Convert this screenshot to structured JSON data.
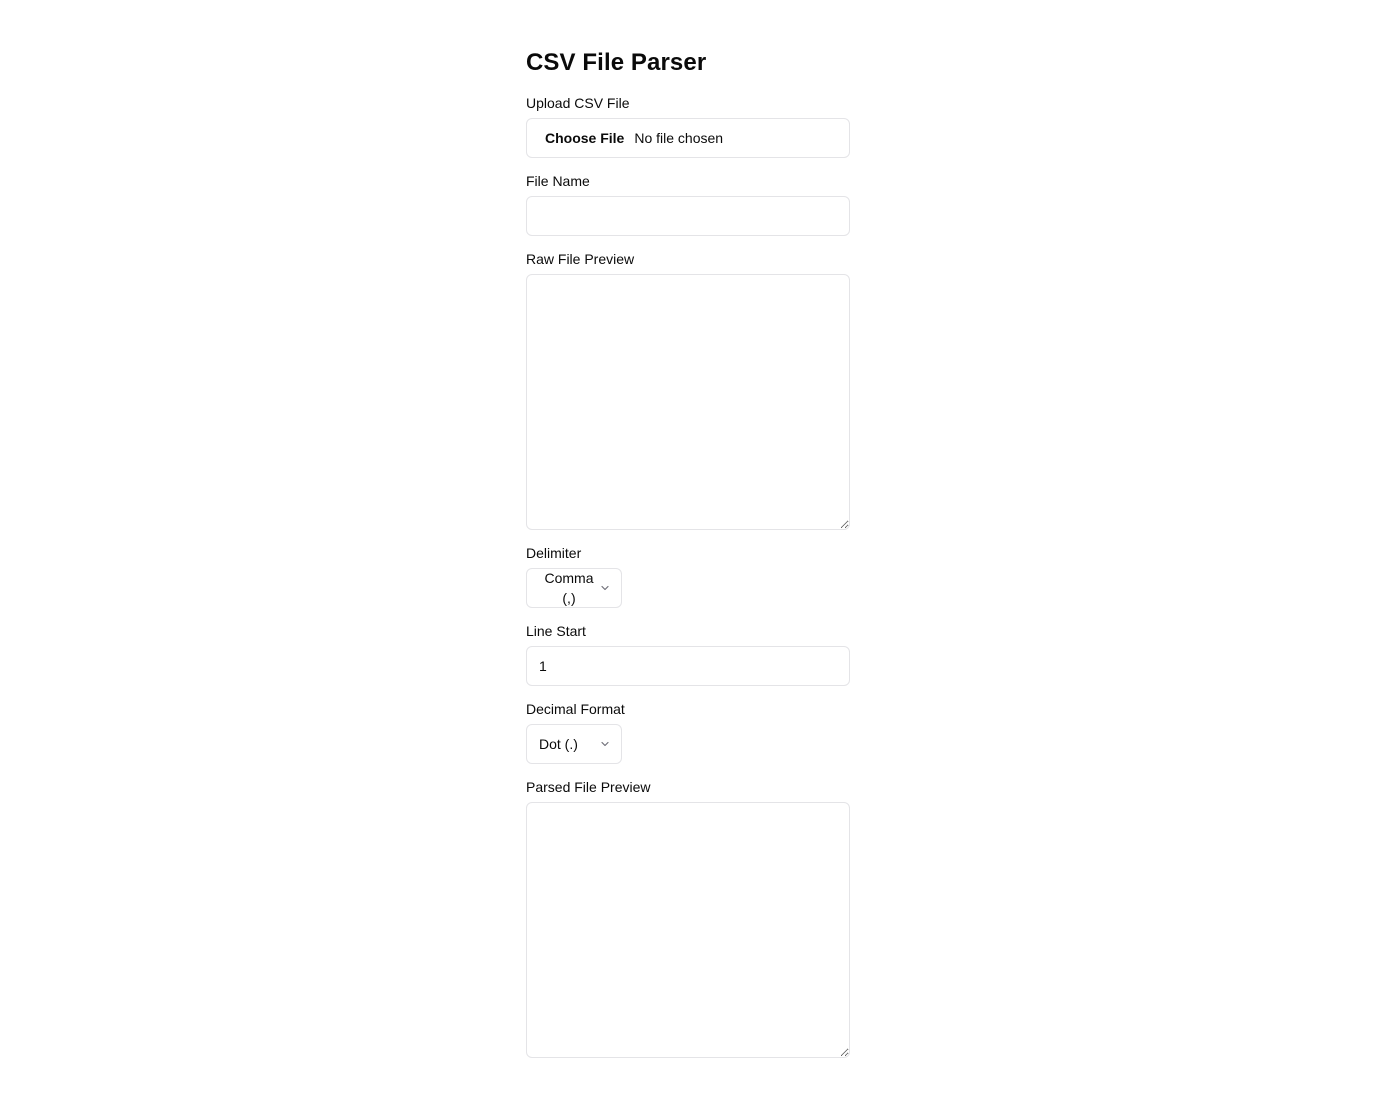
{
  "page": {
    "title": "CSV File Parser"
  },
  "upload": {
    "label": "Upload CSV File",
    "button_label": "Choose File",
    "status": "No file chosen"
  },
  "file_name": {
    "label": "File Name",
    "value": "",
    "placeholder": ""
  },
  "raw_preview": {
    "label": "Raw File Preview",
    "value": ""
  },
  "delimiter": {
    "label": "Delimiter",
    "selected": "Comma (,)",
    "icon": "chevron-down-icon"
  },
  "line_start": {
    "label": "Line Start",
    "value": "1"
  },
  "decimal_format": {
    "label": "Decimal Format",
    "selected": "Dot (.)",
    "icon": "chevron-down-icon"
  },
  "parsed_preview": {
    "label": "Parsed File Preview",
    "value": ""
  },
  "colors": {
    "border": "#e4e4e7",
    "text": "#0a0a0a",
    "background": "#ffffff"
  }
}
